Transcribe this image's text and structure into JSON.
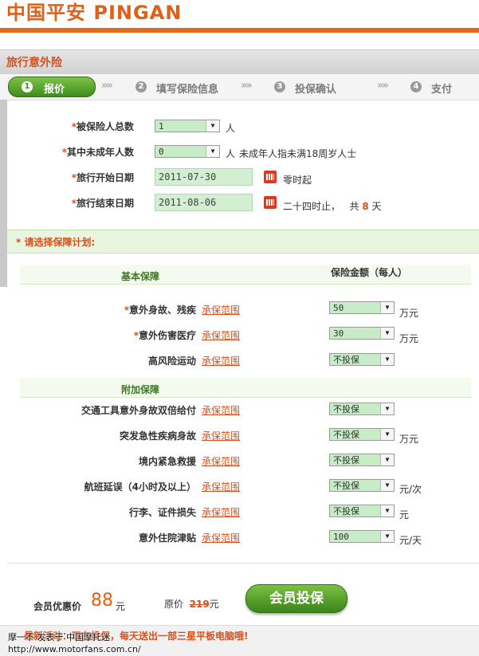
{
  "header": {
    "logo_text": "中国平安 PINGAN",
    "page_title": "旅行意外险"
  },
  "steps": [
    {
      "num": "1",
      "label": "报价"
    },
    {
      "num": "2",
      "label": "填写保险信息"
    },
    {
      "num": "3",
      "label": "投保确认"
    },
    {
      "num": "4",
      "label": "支付"
    }
  ],
  "step_separator": "»»",
  "form": {
    "required_mark": "*",
    "total_insured": {
      "label": "被保险人总数",
      "value": "1",
      "unit": "人"
    },
    "minors": {
      "label": "其中未成年人数",
      "value": "0",
      "unit": "人",
      "note": "未成年人指未满18周岁人士"
    },
    "start_date": {
      "label": "旅行开始日期",
      "value": "2011-07-30",
      "suffix": "零时起"
    },
    "end_date": {
      "label": "旅行结束日期",
      "value": "2011-08-06",
      "suffix": "二十四时止，",
      "total_prefix": "共",
      "days": "8",
      "days_unit": "天"
    }
  },
  "plan": {
    "title": "* 请选择保障计划:",
    "basic_header": "基本保障",
    "amount_header": "保险金额（每人）",
    "extra_header": "附加保障",
    "scope_link": "承保范围",
    "basic": [
      {
        "label": "意外身故、残疾",
        "required": true,
        "value": "50",
        "unit": "万元"
      },
      {
        "label": "意外伤害医疗",
        "required": true,
        "value": "30",
        "unit": "万元"
      },
      {
        "label": "高风险运动",
        "required": false,
        "value": "不投保",
        "unit": ""
      }
    ],
    "extra": [
      {
        "label": "交通工具意外身故双倍给付",
        "value": "不投保",
        "unit": ""
      },
      {
        "label": "突发急性疾病身故",
        "value": "不投保",
        "unit": "万元"
      },
      {
        "label": "境内紧急救援",
        "value": "不投保",
        "unit": ""
      },
      {
        "label": "航班延误（4小时及以上）",
        "value": "不投保",
        "unit": "元/次"
      },
      {
        "label": "行李、证件损失",
        "value": "不投保",
        "unit": "元"
      },
      {
        "label": "意外住院津贴",
        "value": "100",
        "unit": "元/天"
      }
    ]
  },
  "pricing": {
    "member_label": "会员优惠价",
    "member_price": "88",
    "currency": "元",
    "original_label": "原价",
    "original_price": "219",
    "button_label": "会员投保"
  },
  "promo": "最新活动：现在投保，每天送出一部三星平板电脑哦!",
  "watermark": {
    "line1": "摩一不 发表于 中国摩托迷",
    "line2": "http://www.motorfans.com.cn/"
  },
  "colors": {
    "accent_orange": "#e46a1c",
    "required_red": "#d8501c",
    "green": "#3f8c1d"
  }
}
